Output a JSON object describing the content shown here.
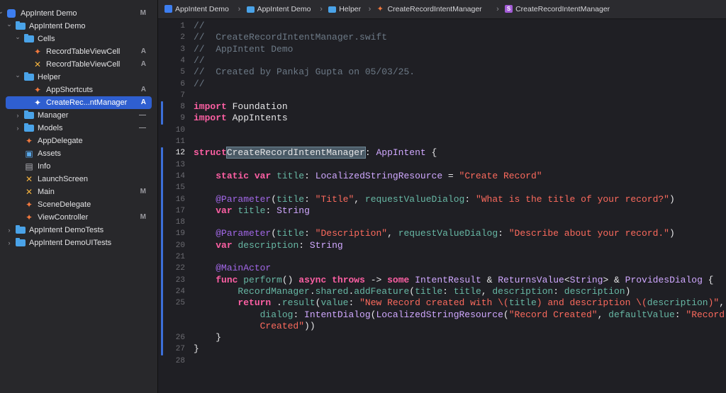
{
  "sidebar": {
    "items": [
      {
        "label": "AppIntent Demo",
        "badge": "M",
        "icon": "project-icon",
        "disclosure": "open"
      },
      {
        "label": "AppIntent Demo",
        "badge": "",
        "icon": "folder-icon",
        "disclosure": "open"
      },
      {
        "label": "Cells",
        "badge": "",
        "icon": "folder-icon",
        "disclosure": "open"
      },
      {
        "label": "RecordTableViewCell",
        "badge": "A",
        "icon": "swift-file-icon",
        "disclosure": ""
      },
      {
        "label": "RecordTableViewCell",
        "badge": "A",
        "icon": "xib-file-icon",
        "disclosure": ""
      },
      {
        "label": "Helper",
        "badge": "",
        "icon": "folder-icon",
        "disclosure": "open"
      },
      {
        "label": "AppShortcuts",
        "badge": "A",
        "icon": "swift-file-icon",
        "disclosure": ""
      },
      {
        "label": "CreateRec...ntManager",
        "badge": "A",
        "icon": "swift-file-icon",
        "disclosure": "",
        "selected": true
      },
      {
        "label": "Manager",
        "badge": "—",
        "icon": "folder-icon",
        "disclosure": "closed"
      },
      {
        "label": "Models",
        "badge": "—",
        "icon": "folder-icon",
        "disclosure": "closed"
      },
      {
        "label": "AppDelegate",
        "badge": "",
        "icon": "swift-file-icon",
        "disclosure": ""
      },
      {
        "label": "Assets",
        "badge": "",
        "icon": "assets-icon",
        "disclosure": ""
      },
      {
        "label": "Info",
        "badge": "",
        "icon": "plist-icon",
        "disclosure": ""
      },
      {
        "label": "LaunchScreen",
        "badge": "",
        "icon": "storyboard-icon",
        "disclosure": ""
      },
      {
        "label": "Main",
        "badge": "M",
        "icon": "storyboard-icon",
        "disclosure": ""
      },
      {
        "label": "SceneDelegate",
        "badge": "",
        "icon": "swift-file-icon",
        "disclosure": ""
      },
      {
        "label": "ViewController",
        "badge": "M",
        "icon": "swift-file-icon",
        "disclosure": ""
      },
      {
        "label": "AppIntent DemoTests",
        "badge": "",
        "icon": "folder-icon",
        "disclosure": "closed"
      },
      {
        "label": "AppIntent DemoUITests",
        "badge": "",
        "icon": "folder-icon",
        "disclosure": "closed"
      }
    ]
  },
  "breadcrumb": {
    "items": [
      {
        "label": "AppIntent Demo",
        "icon": "project-icon"
      },
      {
        "label": "AppIntent Demo",
        "icon": "folder-icon"
      },
      {
        "label": "Helper",
        "icon": "folder-icon"
      },
      {
        "label": "CreateRecordIntentManager",
        "icon": "swift-file-icon"
      },
      {
        "label": "CreateRecordIntentManager",
        "icon": "struct-icon"
      }
    ],
    "struct_letter": "S"
  },
  "editor": {
    "current_line": 12,
    "lines": [
      {
        "n": "1",
        "tokens": [
          [
            "c",
            "//"
          ]
        ]
      },
      {
        "n": "2",
        "tokens": [
          [
            "c",
            "//  CreateRecordIntentManager.swift"
          ]
        ]
      },
      {
        "n": "3",
        "tokens": [
          [
            "c",
            "//  AppIntent Demo"
          ]
        ]
      },
      {
        "n": "4",
        "tokens": [
          [
            "c",
            "//"
          ]
        ]
      },
      {
        "n": "5",
        "tokens": [
          [
            "c",
            "//  Created by Pankaj Gupta on 05/03/25."
          ]
        ]
      },
      {
        "n": "6",
        "tokens": [
          [
            "c",
            "//"
          ]
        ]
      },
      {
        "n": "7",
        "tokens": []
      },
      {
        "n": "8",
        "tokens": [
          [
            "k",
            "import"
          ],
          [
            "",
            "Foundation"
          ]
        ]
      },
      {
        "n": "9",
        "tokens": [
          [
            "k",
            "import"
          ],
          [
            "",
            "AppIntents"
          ]
        ]
      },
      {
        "n": "10",
        "tokens": []
      },
      {
        "n": "11",
        "tokens": []
      },
      {
        "n": "12",
        "tokens": [
          [
            "k",
            "struct"
          ],
          [
            "",
            ""
          ],
          [
            "hl",
            "CreateRecordIntentManager"
          ],
          [
            "",
            ": "
          ],
          [
            "t",
            "AppIntent"
          ],
          [
            "",
            " {"
          ]
        ]
      },
      {
        "n": "13",
        "tokens": []
      },
      {
        "n": "14",
        "tokens": [
          [
            "",
            "    "
          ],
          [
            "k",
            "static"
          ],
          [
            "",
            " "
          ],
          [
            "k",
            "var"
          ],
          [
            "",
            " "
          ],
          [
            "f",
            "title"
          ],
          [
            "",
            ": "
          ],
          [
            "t",
            "LocalizedStringResource"
          ],
          [
            "",
            " = "
          ],
          [
            "s",
            "\"Create Record\""
          ]
        ]
      },
      {
        "n": "15",
        "tokens": []
      },
      {
        "n": "16",
        "tokens": [
          [
            "",
            "    "
          ],
          [
            "p",
            "@Parameter"
          ],
          [
            "",
            "("
          ],
          [
            "f",
            "title"
          ],
          [
            "",
            ": "
          ],
          [
            "s",
            "\"Title\""
          ],
          [
            "",
            ", "
          ],
          [
            "f",
            "requestValueDialog"
          ],
          [
            "",
            ": "
          ],
          [
            "s",
            "\"What is the title of your record?\""
          ],
          [
            "",
            ")"
          ]
        ]
      },
      {
        "n": "17",
        "tokens": [
          [
            "",
            "    "
          ],
          [
            "k",
            "var"
          ],
          [
            "",
            " "
          ],
          [
            "f",
            "title"
          ],
          [
            "",
            ": "
          ],
          [
            "t",
            "String"
          ]
        ]
      },
      {
        "n": "18",
        "tokens": []
      },
      {
        "n": "19",
        "tokens": [
          [
            "",
            "    "
          ],
          [
            "p",
            "@Parameter"
          ],
          [
            "",
            "("
          ],
          [
            "f",
            "title"
          ],
          [
            "",
            ": "
          ],
          [
            "s",
            "\"Description\""
          ],
          [
            "",
            ", "
          ],
          [
            "f",
            "requestValueDialog"
          ],
          [
            "",
            ": "
          ],
          [
            "s",
            "\"Describe about your record.\""
          ],
          [
            "",
            ")"
          ]
        ]
      },
      {
        "n": "20",
        "tokens": [
          [
            "",
            "    "
          ],
          [
            "k",
            "var"
          ],
          [
            "",
            " "
          ],
          [
            "f",
            "description"
          ],
          [
            "",
            ": "
          ],
          [
            "t",
            "String"
          ]
        ]
      },
      {
        "n": "21",
        "tokens": []
      },
      {
        "n": "22",
        "tokens": [
          [
            "",
            "    "
          ],
          [
            "p",
            "@MainActor"
          ]
        ]
      },
      {
        "n": "23",
        "tokens": [
          [
            "",
            "    "
          ],
          [
            "k",
            "func"
          ],
          [
            "",
            " "
          ],
          [
            "f",
            "perform"
          ],
          [
            "",
            "() "
          ],
          [
            "k",
            "async"
          ],
          [
            "",
            " "
          ],
          [
            "k",
            "throws"
          ],
          [
            "",
            " -> "
          ],
          [
            "k",
            "some"
          ],
          [
            "",
            " "
          ],
          [
            "t",
            "IntentResult"
          ],
          [
            "",
            " & "
          ],
          [
            "t",
            "ReturnsValue"
          ],
          [
            "",
            "<"
          ],
          [
            "t",
            "String"
          ],
          [
            "",
            "> & "
          ],
          [
            "t",
            "ProvidesDialog"
          ],
          [
            "",
            " {"
          ]
        ]
      },
      {
        "n": "24",
        "tokens": [
          [
            "",
            "        "
          ],
          [
            "f",
            "RecordManager"
          ],
          [
            "",
            "."
          ],
          [
            "f",
            "shared"
          ],
          [
            "",
            "."
          ],
          [
            "f",
            "addFeature"
          ],
          [
            "",
            "("
          ],
          [
            "f",
            "title"
          ],
          [
            "",
            ": "
          ],
          [
            "f",
            "title"
          ],
          [
            "",
            ", "
          ],
          [
            "f",
            "description"
          ],
          [
            "",
            ": "
          ],
          [
            "f",
            "description"
          ],
          [
            "",
            ")"
          ]
        ]
      },
      {
        "n": "25",
        "tokens": [
          [
            "",
            "        "
          ],
          [
            "k",
            "return"
          ],
          [
            "",
            " ."
          ],
          [
            "f",
            "result"
          ],
          [
            "",
            "("
          ],
          [
            "f",
            "value"
          ],
          [
            "",
            ": "
          ],
          [
            "s",
            "\"New Record created with \\("
          ],
          [
            "f",
            "title"
          ],
          [
            "s",
            ") and description \\("
          ],
          [
            "f",
            "description"
          ],
          [
            "s",
            ")\""
          ],
          [
            "",
            ","
          ]
        ]
      },
      {
        "n": "",
        "tokens": [
          [
            "",
            "            "
          ],
          [
            "f",
            "dialog"
          ],
          [
            "",
            ": "
          ],
          [
            "t",
            "IntentDialog"
          ],
          [
            "",
            "("
          ],
          [
            "t",
            "LocalizedStringResource"
          ],
          [
            "",
            "("
          ],
          [
            "s",
            "\"Record Created\""
          ],
          [
            "",
            ", "
          ],
          [
            "f",
            "defaultValue"
          ],
          [
            "",
            ": "
          ],
          [
            "s",
            "\"Record"
          ]
        ]
      },
      {
        "n": "",
        "tokens": [
          [
            "",
            "            "
          ],
          [
            "s",
            "Created\""
          ],
          [
            "",
            "))"
          ]
        ]
      },
      {
        "n": "26",
        "tokens": [
          [
            "",
            "    }"
          ]
        ]
      },
      {
        "n": "27",
        "tokens": [
          [
            "",
            "}"
          ]
        ]
      },
      {
        "n": "28",
        "tokens": []
      }
    ]
  },
  "colors": {
    "accent": "#2f5fd0",
    "keyword": "#fc5fa3",
    "string": "#fc6a5d",
    "comment": "#6c7986",
    "type": "#d0a8ff",
    "function": "#67b7a4"
  }
}
